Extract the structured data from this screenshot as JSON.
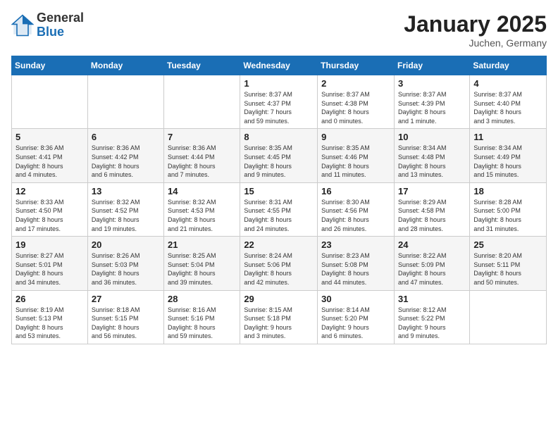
{
  "header": {
    "logo_general": "General",
    "logo_blue": "Blue",
    "month_title": "January 2025",
    "location": "Juchen, Germany"
  },
  "weekdays": [
    "Sunday",
    "Monday",
    "Tuesday",
    "Wednesday",
    "Thursday",
    "Friday",
    "Saturday"
  ],
  "weeks": [
    [
      {
        "day": "",
        "info": ""
      },
      {
        "day": "",
        "info": ""
      },
      {
        "day": "",
        "info": ""
      },
      {
        "day": "1",
        "info": "Sunrise: 8:37 AM\nSunset: 4:37 PM\nDaylight: 7 hours\nand 59 minutes."
      },
      {
        "day": "2",
        "info": "Sunrise: 8:37 AM\nSunset: 4:38 PM\nDaylight: 8 hours\nand 0 minutes."
      },
      {
        "day": "3",
        "info": "Sunrise: 8:37 AM\nSunset: 4:39 PM\nDaylight: 8 hours\nand 1 minute."
      },
      {
        "day": "4",
        "info": "Sunrise: 8:37 AM\nSunset: 4:40 PM\nDaylight: 8 hours\nand 3 minutes."
      }
    ],
    [
      {
        "day": "5",
        "info": "Sunrise: 8:36 AM\nSunset: 4:41 PM\nDaylight: 8 hours\nand 4 minutes."
      },
      {
        "day": "6",
        "info": "Sunrise: 8:36 AM\nSunset: 4:42 PM\nDaylight: 8 hours\nand 6 minutes."
      },
      {
        "day": "7",
        "info": "Sunrise: 8:36 AM\nSunset: 4:44 PM\nDaylight: 8 hours\nand 7 minutes."
      },
      {
        "day": "8",
        "info": "Sunrise: 8:35 AM\nSunset: 4:45 PM\nDaylight: 8 hours\nand 9 minutes."
      },
      {
        "day": "9",
        "info": "Sunrise: 8:35 AM\nSunset: 4:46 PM\nDaylight: 8 hours\nand 11 minutes."
      },
      {
        "day": "10",
        "info": "Sunrise: 8:34 AM\nSunset: 4:48 PM\nDaylight: 8 hours\nand 13 minutes."
      },
      {
        "day": "11",
        "info": "Sunrise: 8:34 AM\nSunset: 4:49 PM\nDaylight: 8 hours\nand 15 minutes."
      }
    ],
    [
      {
        "day": "12",
        "info": "Sunrise: 8:33 AM\nSunset: 4:50 PM\nDaylight: 8 hours\nand 17 minutes."
      },
      {
        "day": "13",
        "info": "Sunrise: 8:32 AM\nSunset: 4:52 PM\nDaylight: 8 hours\nand 19 minutes."
      },
      {
        "day": "14",
        "info": "Sunrise: 8:32 AM\nSunset: 4:53 PM\nDaylight: 8 hours\nand 21 minutes."
      },
      {
        "day": "15",
        "info": "Sunrise: 8:31 AM\nSunset: 4:55 PM\nDaylight: 8 hours\nand 24 minutes."
      },
      {
        "day": "16",
        "info": "Sunrise: 8:30 AM\nSunset: 4:56 PM\nDaylight: 8 hours\nand 26 minutes."
      },
      {
        "day": "17",
        "info": "Sunrise: 8:29 AM\nSunset: 4:58 PM\nDaylight: 8 hours\nand 28 minutes."
      },
      {
        "day": "18",
        "info": "Sunrise: 8:28 AM\nSunset: 5:00 PM\nDaylight: 8 hours\nand 31 minutes."
      }
    ],
    [
      {
        "day": "19",
        "info": "Sunrise: 8:27 AM\nSunset: 5:01 PM\nDaylight: 8 hours\nand 34 minutes."
      },
      {
        "day": "20",
        "info": "Sunrise: 8:26 AM\nSunset: 5:03 PM\nDaylight: 8 hours\nand 36 minutes."
      },
      {
        "day": "21",
        "info": "Sunrise: 8:25 AM\nSunset: 5:04 PM\nDaylight: 8 hours\nand 39 minutes."
      },
      {
        "day": "22",
        "info": "Sunrise: 8:24 AM\nSunset: 5:06 PM\nDaylight: 8 hours\nand 42 minutes."
      },
      {
        "day": "23",
        "info": "Sunrise: 8:23 AM\nSunset: 5:08 PM\nDaylight: 8 hours\nand 44 minutes."
      },
      {
        "day": "24",
        "info": "Sunrise: 8:22 AM\nSunset: 5:09 PM\nDaylight: 8 hours\nand 47 minutes."
      },
      {
        "day": "25",
        "info": "Sunrise: 8:20 AM\nSunset: 5:11 PM\nDaylight: 8 hours\nand 50 minutes."
      }
    ],
    [
      {
        "day": "26",
        "info": "Sunrise: 8:19 AM\nSunset: 5:13 PM\nDaylight: 8 hours\nand 53 minutes."
      },
      {
        "day": "27",
        "info": "Sunrise: 8:18 AM\nSunset: 5:15 PM\nDaylight: 8 hours\nand 56 minutes."
      },
      {
        "day": "28",
        "info": "Sunrise: 8:16 AM\nSunset: 5:16 PM\nDaylight: 8 hours\nand 59 minutes."
      },
      {
        "day": "29",
        "info": "Sunrise: 8:15 AM\nSunset: 5:18 PM\nDaylight: 9 hours\nand 3 minutes."
      },
      {
        "day": "30",
        "info": "Sunrise: 8:14 AM\nSunset: 5:20 PM\nDaylight: 9 hours\nand 6 minutes."
      },
      {
        "day": "31",
        "info": "Sunrise: 8:12 AM\nSunset: 5:22 PM\nDaylight: 9 hours\nand 9 minutes."
      },
      {
        "day": "",
        "info": ""
      }
    ]
  ]
}
